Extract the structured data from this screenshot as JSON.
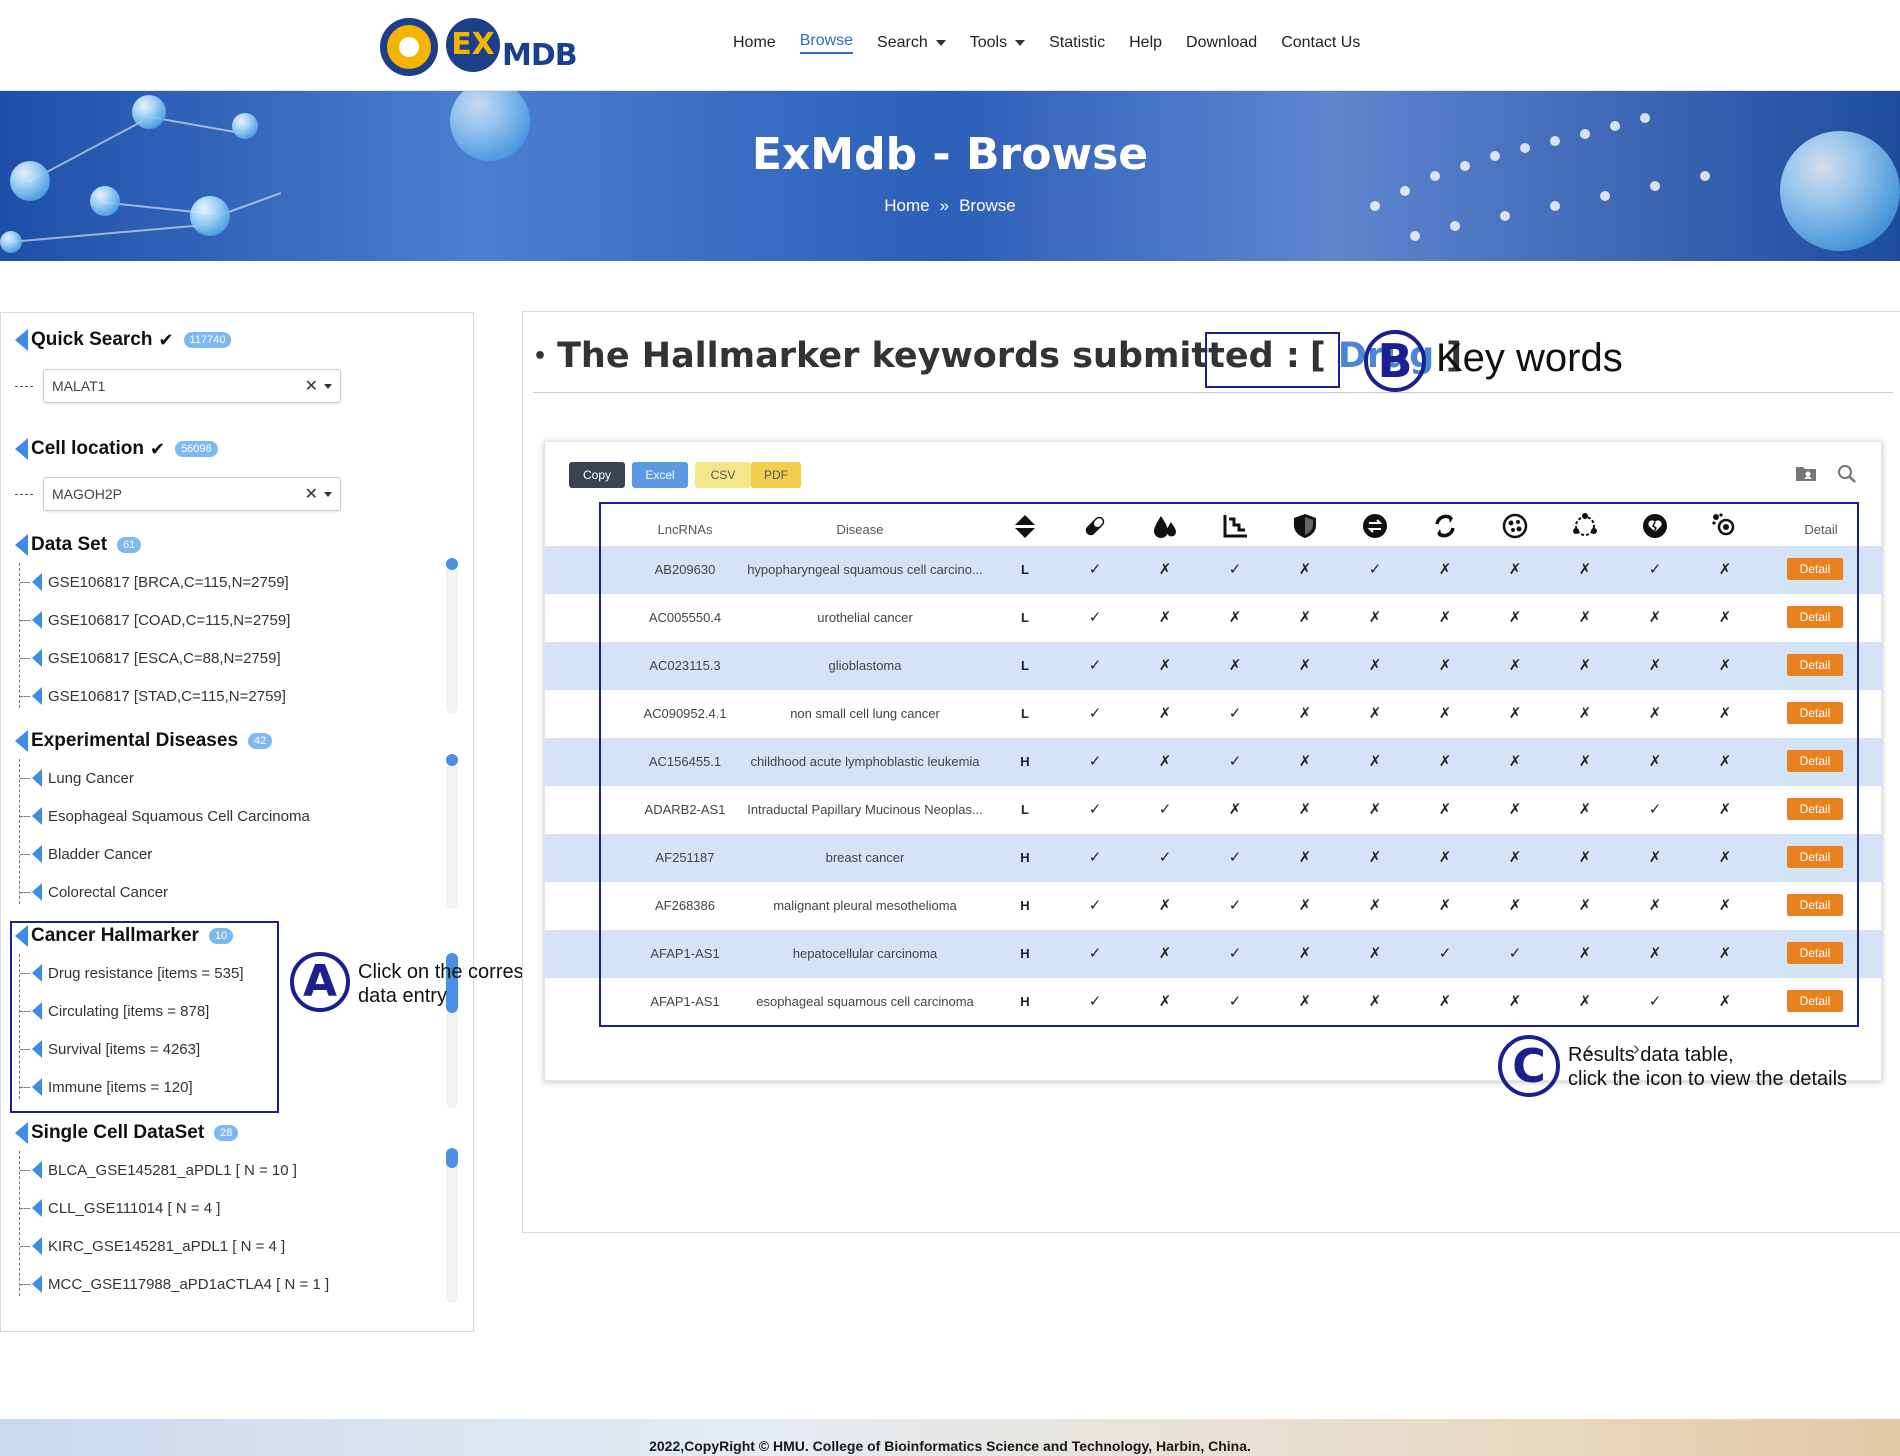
{
  "header": {
    "logo_ex": "EX",
    "logo_mdb": "MDB",
    "nav": [
      "Home",
      "Browse",
      "Search",
      "Tools",
      "Statistic",
      "Help",
      "Download",
      "Contact Us"
    ]
  },
  "banner": {
    "title": "ExMdb - Browse",
    "crumb_home": "Home",
    "crumb_sep": "»",
    "crumb_current": "Browse"
  },
  "sidebar": {
    "quick_search": {
      "title": "Quick Search",
      "check": "✔",
      "count": "117740",
      "value": "MALAT1"
    },
    "cell_location": {
      "title": "Cell location",
      "check": "✔",
      "count": "56098",
      "value": "MAGOH2P"
    },
    "data_set": {
      "title": "Data Set",
      "count": "61",
      "items": [
        "GSE106817 [BRCA,C=115,N=2759]",
        "GSE106817 [COAD,C=115,N=2759]",
        "GSE106817 [ESCA,C=88,N=2759]",
        "GSE106817 [STAD,C=115,N=2759]"
      ]
    },
    "experimental_diseases": {
      "title": "Experimental Diseases",
      "count": "42",
      "items": [
        "Lung Cancer",
        "Esophageal Squamous Cell Carcinoma",
        "Bladder Cancer",
        "Colorectal Cancer"
      ]
    },
    "cancer_hallmarker": {
      "title": "Cancer Hallmarker",
      "count": "10",
      "items": [
        "Drug resistance [items = 535]",
        "Circulating [items = 878]",
        "Survival [items = 4263]",
        "Immune [items = 120]"
      ]
    },
    "single_cell": {
      "title": "Single Cell DataSet",
      "count": "28",
      "items": [
        "BLCA_GSE145281_aPDL1 [ N = 10 ]",
        "CLL_GSE111014 [ N = 4 ]",
        "KIRC_GSE145281_aPDL1 [ N = 4 ]",
        "MCC_GSE117988_aPD1aCTLA4 [ N = 1 ]"
      ]
    },
    "clear_glyph": "✕"
  },
  "main": {
    "heading_prefix": "The Hallmarker keywords submitted :",
    "bracket_open": "[",
    "keyword": "Drug",
    "bracket_close": "]"
  },
  "table": {
    "buttons": {
      "copy": "Copy",
      "excel": "Excel",
      "csv": "CSV",
      "pdf": "PDF"
    },
    "col_lncrna": "LncRNAs",
    "col_disease": "Disease",
    "col_detail": "Detail",
    "detail_label": "Detail",
    "rows": [
      {
        "lnc": "AB209630",
        "disease": "hypopharyngeal squamous cell carcino...",
        "exp": "L",
        "marks": [
          "✓",
          "✗",
          "✓",
          "✗",
          "✓",
          "✗",
          "✗",
          "✗",
          "✓",
          "✗"
        ]
      },
      {
        "lnc": "AC005550.4",
        "disease": "urothelial cancer",
        "exp": "L",
        "marks": [
          "✓",
          "✗",
          "✗",
          "✗",
          "✗",
          "✗",
          "✗",
          "✗",
          "✗",
          "✗"
        ]
      },
      {
        "lnc": "AC023115.3",
        "disease": "glioblastoma",
        "exp": "L",
        "marks": [
          "✓",
          "✗",
          "✗",
          "✗",
          "✗",
          "✗",
          "✗",
          "✗",
          "✗",
          "✗"
        ]
      },
      {
        "lnc": "AC090952.4.1",
        "disease": "non small cell lung cancer",
        "exp": "L",
        "marks": [
          "✓",
          "✗",
          "✓",
          "✗",
          "✗",
          "✗",
          "✗",
          "✗",
          "✗",
          "✗"
        ]
      },
      {
        "lnc": "AC156455.1",
        "disease": "childhood acute lymphoblastic leukemia",
        "exp": "H",
        "marks": [
          "✓",
          "✗",
          "✓",
          "✗",
          "✗",
          "✗",
          "✗",
          "✗",
          "✗",
          "✗"
        ]
      },
      {
        "lnc": "ADARB2-AS1",
        "disease": "Intraductal Papillary Mucinous Neoplas...",
        "exp": "L",
        "marks": [
          "✓",
          "✓",
          "✗",
          "✗",
          "✗",
          "✗",
          "✗",
          "✗",
          "✓",
          "✗"
        ]
      },
      {
        "lnc": "AF251187",
        "disease": "breast cancer",
        "exp": "H",
        "marks": [
          "✓",
          "✓",
          "✓",
          "✗",
          "✗",
          "✗",
          "✗",
          "✗",
          "✗",
          "✗"
        ]
      },
      {
        "lnc": "AF268386",
        "disease": "malignant pleural mesothelioma",
        "exp": "H",
        "marks": [
          "✓",
          "✗",
          "✓",
          "✗",
          "✗",
          "✗",
          "✗",
          "✗",
          "✗",
          "✗"
        ]
      },
      {
        "lnc": "AFAP1-AS1",
        "disease": "hepatocellular carcinoma",
        "exp": "H",
        "marks": [
          "✓",
          "✗",
          "✓",
          "✗",
          "✗",
          "✓",
          "✓",
          "✗",
          "✗",
          "✗"
        ]
      },
      {
        "lnc": "AFAP1-AS1",
        "disease": "esophageal squamous cell carcinoma",
        "exp": "H",
        "marks": [
          "✓",
          "✗",
          "✓",
          "✗",
          "✗",
          "✗",
          "✗",
          "✗",
          "✓",
          "✗"
        ]
      }
    ],
    "pager_prev": "‹",
    "pager_next": "›"
  },
  "annotations": {
    "a_letter": "A",
    "a_text_1": "Click on the corresponding",
    "a_text_2": "data entry",
    "b_letter": "B",
    "b_text": "Key words",
    "c_letter": "C",
    "c_text_1": "Results data table,",
    "c_text_2": "click the icon to view the details"
  },
  "colors": {
    "accent": "#2a6fc9",
    "annotation": "#1b1f8f",
    "detail_button": "#e9811f",
    "row_highlight": "#d4e3f7"
  },
  "footer": {
    "text": "2022,CopyRight © HMU. College of Bioinformatics Science and Technology, Harbin, China."
  }
}
